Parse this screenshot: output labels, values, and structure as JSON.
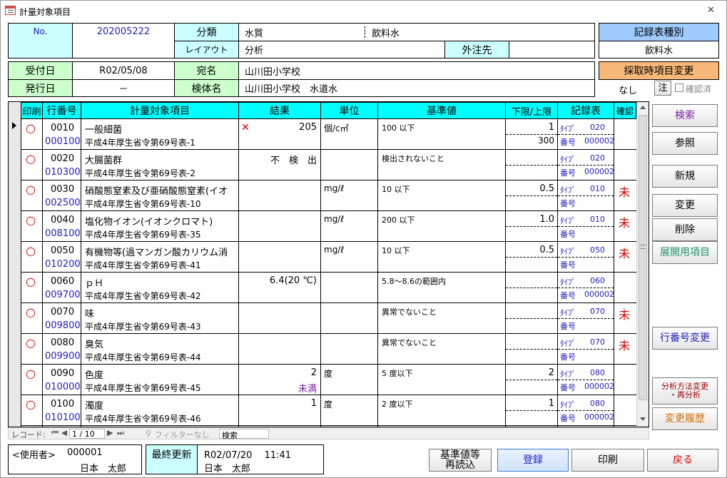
{
  "window": {
    "title": "計量対象項目",
    "close_glyph": "✕"
  },
  "header": {
    "no_label": "No.",
    "no_value": "202005222",
    "bunrui_label": "分類",
    "bunrui_value1": "水質",
    "bunrui_value2": "飲料水",
    "layout_label": "レイアウト",
    "layout_value": "分析",
    "gaichu_label": "外注先",
    "gaichu_value": "",
    "record_type_label": "記録表種別",
    "record_type_value": "飲料水",
    "uketsuke_label": "受付日",
    "uketsuke_value": "R02/05/08",
    "hakko_label": "発行日",
    "hakko_value": "－",
    "atena_label": "宛名",
    "atena_value": "山川田小学校",
    "kentai_label": "検体名",
    "kentai_value": "山川田小学校　水道水",
    "change_label": "採取時項目変更",
    "change_value": "なし",
    "chu_label": "注",
    "confirmed_label": "確認済"
  },
  "table": {
    "columns": [
      "印刷",
      "行番号",
      "計量対象項目",
      "結果",
      "単位",
      "基準値",
      "下限/上限",
      "記録表",
      "確認"
    ],
    "type_label": "ﾀｲﾌﾟ",
    "bango_label": "番号",
    "rows": [
      {
        "mark": "○",
        "no": "0010",
        "code": "000100",
        "name": "一般細菌",
        "law": "平成4年厚生省令第69号表-1",
        "result_mark": "✕",
        "result": "205",
        "result2": "",
        "unit": "個/c㎡",
        "kijun": "100 以下",
        "lower": "1",
        "upper": "300",
        "type": "020",
        "bango": "000002",
        "kakunin": ""
      },
      {
        "mark": "○",
        "no": "0020",
        "code": "010300",
        "name": "大腸菌群",
        "law": "平成4年厚生省令第69号表-2",
        "result_mark": "",
        "result": "不　検　出",
        "result2": "",
        "unit": "",
        "kijun": "検出されないこと",
        "lower": "",
        "upper": "",
        "type": "020",
        "bango": "000002",
        "kakunin": ""
      },
      {
        "mark": "○",
        "no": "0030",
        "code": "002500",
        "name": "硝酸態窒素及び亜硝酸態窒素(イオ",
        "law": "平成4年厚生省令第69号表-10",
        "result_mark": "",
        "result": "",
        "result2": "",
        "unit": "mg/ℓ",
        "kijun": "10 以下",
        "lower": "0.5",
        "upper": "",
        "type": "010",
        "bango": "",
        "kakunin": "未"
      },
      {
        "mark": "○",
        "no": "0040",
        "code": "008100",
        "name": "塩化物イオン(イオンクロマト)",
        "law": "平成4年厚生省令第69号表-35",
        "result_mark": "",
        "result": "",
        "result2": "",
        "unit": "mg/ℓ",
        "kijun": "200 以下",
        "lower": "1.0",
        "upper": "",
        "type": "010",
        "bango": "",
        "kakunin": "未"
      },
      {
        "mark": "○",
        "no": "0050",
        "code": "010200",
        "name": "有機物等(過マンガン酸カリウム消",
        "law": "平成4年厚生省令第69号表-41",
        "result_mark": "",
        "result": "",
        "result2": "",
        "unit": "mg/ℓ",
        "kijun": "10 以下",
        "lower": "0.5",
        "upper": "",
        "type": "050",
        "bango": "",
        "kakunin": "未"
      },
      {
        "mark": "○",
        "no": "0060",
        "code": "009700",
        "name": "ｐＨ",
        "law": "平成4年厚生省令第69号表-42",
        "result_mark": "",
        "result": "6.4(20 ℃)",
        "result2": "",
        "unit": "",
        "kijun": "5.8～8.6の範囲内",
        "lower": "",
        "upper": "",
        "type": "060",
        "bango": "000002",
        "kakunin": ""
      },
      {
        "mark": "○",
        "no": "0070",
        "code": "009800",
        "name": "味",
        "law": "平成4年厚生省令第69号表-43",
        "result_mark": "",
        "result": "",
        "result2": "",
        "unit": "",
        "kijun": "異常でないこと",
        "lower": "",
        "upper": "",
        "type": "070",
        "bango": "",
        "kakunin": "未"
      },
      {
        "mark": "○",
        "no": "0080",
        "code": "009900",
        "name": "臭気",
        "law": "平成4年厚生省令第69号表-44",
        "result_mark": "",
        "result": "",
        "result2": "",
        "unit": "",
        "kijun": "異常でないこと",
        "lower": "",
        "upper": "",
        "type": "070",
        "bango": "",
        "kakunin": "未"
      },
      {
        "mark": "○",
        "no": "0090",
        "code": "010000",
        "name": "色度",
        "law": "平成4年厚生省令第69号表-45",
        "result_mark": "",
        "result": "2",
        "result2": "未満",
        "unit": "度",
        "kijun": "5 度以下",
        "lower": "2",
        "upper": "",
        "type": "080",
        "bango": "000002",
        "kakunin": ""
      },
      {
        "mark": "○",
        "no": "0100",
        "code": "010100",
        "name": "濁度",
        "law": "平成4年厚生省令第69号表-46",
        "result_mark": "",
        "result": "1",
        "result2": "",
        "unit": "度",
        "kijun": "2 度以下",
        "lower": "1",
        "upper": "",
        "type": "080",
        "bango": "000002",
        "kakunin": ""
      }
    ]
  },
  "record_nav": {
    "label": "レコード:",
    "current": "1 / 10",
    "filter": "フィルターなし",
    "search_placeholder": "検索"
  },
  "side_buttons": {
    "kensaku": "検索",
    "sansho": "参照",
    "shinki": "新規",
    "henko": "変更",
    "sakujo": "削除",
    "tenkai": "展開用項目",
    "gyo_henko": "行番号変更",
    "bunseki1": "分析方法変更",
    "bunseki2": "・再分析",
    "rireki": "変更履歴"
  },
  "footer": {
    "user_label": "<使用者>",
    "user_id": "000001",
    "user_name": "日本　太郎",
    "updated_label": "最終更新",
    "updated_at": "R02/07/20　 11:41",
    "updated_by": "日本　太郎",
    "reload1": "基準値等",
    "reload2": "再読込",
    "register": "登録",
    "print": "印刷",
    "back": "戻る"
  },
  "colors": {
    "accent_blue": "#1f1fbf",
    "red": "#e00000",
    "cyan": "#00ffff",
    "green": "#ccffcc",
    "purple": "#7a1f9f",
    "teal": "#1f8f6f",
    "orange": "#d0700a"
  }
}
